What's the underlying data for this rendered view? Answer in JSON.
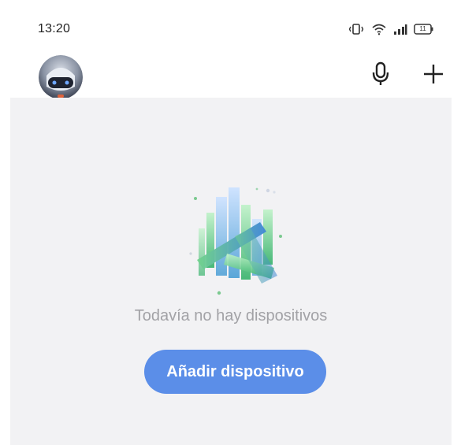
{
  "status_bar": {
    "time": "13:20",
    "battery_level": "11",
    "icons": [
      "vibrate-icon",
      "wifi-icon",
      "cellular-signal-icon",
      "battery-icon"
    ]
  },
  "header": {
    "avatar_icon": "robot-avatar-icon",
    "mic_icon": "microphone-icon",
    "add_icon": "plus-icon"
  },
  "empty_state": {
    "illustration_icon": "smart-home-buildings-illustration",
    "message": "Todavía no hay dispositivos",
    "add_button_label": "Añadir dispositivo"
  },
  "colors": {
    "accent": "#5b8ee8",
    "background": "#f2f2f4",
    "muted_text": "#a2a2a6"
  }
}
